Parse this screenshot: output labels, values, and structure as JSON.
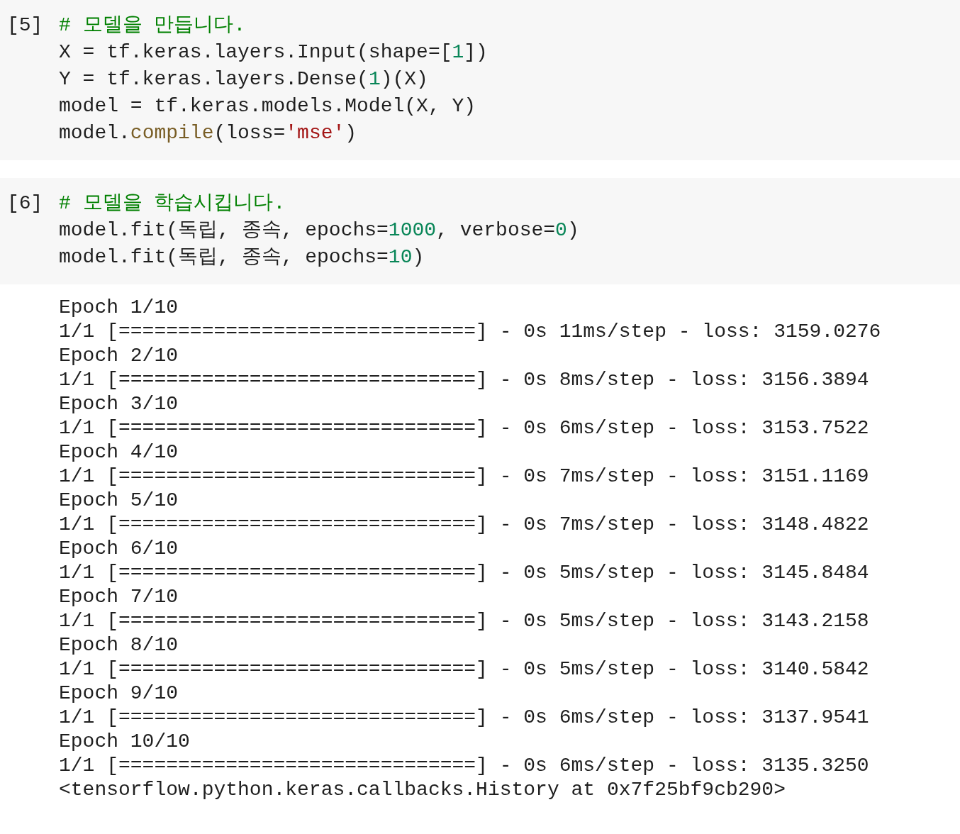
{
  "cells": [
    {
      "prompt": "[5]",
      "lines": [
        [
          {
            "kind": "comment",
            "text": "# 모델을 만듭니다."
          }
        ],
        [
          {
            "kind": "plain",
            "text": "X = tf.keras.layers.Input(shape=["
          },
          {
            "kind": "number",
            "text": "1"
          },
          {
            "kind": "plain",
            "text": "])"
          }
        ],
        [
          {
            "kind": "plain",
            "text": "Y = tf.keras.layers.Dense("
          },
          {
            "kind": "number",
            "text": "1"
          },
          {
            "kind": "plain",
            "text": ")(X)"
          }
        ],
        [
          {
            "kind": "plain",
            "text": "model = tf.keras.models.Model(X, Y)"
          }
        ],
        [
          {
            "kind": "plain",
            "text": "model."
          },
          {
            "kind": "function",
            "text": "compile"
          },
          {
            "kind": "plain",
            "text": "(loss="
          },
          {
            "kind": "string",
            "text": "'mse'"
          },
          {
            "kind": "plain",
            "text": ")"
          }
        ]
      ]
    },
    {
      "prompt": "[6]",
      "lines": [
        [
          {
            "kind": "comment",
            "text": "# 모델을 학습시킵니다."
          }
        ],
        [
          {
            "kind": "plain",
            "text": "model.fit(독립, 종속, epochs="
          },
          {
            "kind": "number",
            "text": "1000"
          },
          {
            "kind": "plain",
            "text": ", verbose="
          },
          {
            "kind": "number",
            "text": "0"
          },
          {
            "kind": "plain",
            "text": ")"
          }
        ],
        [
          {
            "kind": "plain",
            "text": "model.fit(독립, 종속, epochs="
          },
          {
            "kind": "number",
            "text": "10"
          },
          {
            "kind": "plain",
            "text": ")"
          }
        ]
      ],
      "output": [
        "Epoch 1/10",
        "1/1 [==============================] - 0s 11ms/step - loss: 3159.0276",
        "Epoch 2/10",
        "1/1 [==============================] - 0s 8ms/step - loss: 3156.3894",
        "Epoch 3/10",
        "1/1 [==============================] - 0s 6ms/step - loss: 3153.7522",
        "Epoch 4/10",
        "1/1 [==============================] - 0s 7ms/step - loss: 3151.1169",
        "Epoch 5/10",
        "1/1 [==============================] - 0s 7ms/step - loss: 3148.4822",
        "Epoch 6/10",
        "1/1 [==============================] - 0s 5ms/step - loss: 3145.8484",
        "Epoch 7/10",
        "1/1 [==============================] - 0s 5ms/step - loss: 3143.2158",
        "Epoch 8/10",
        "1/1 [==============================] - 0s 5ms/step - loss: 3140.5842",
        "Epoch 9/10",
        "1/1 [==============================] - 0s 6ms/step - loss: 3137.9541",
        "Epoch 10/10",
        "1/1 [==============================] - 0s 6ms/step - loss: 3135.3250",
        "<tensorflow.python.keras.callbacks.History at 0x7f25bf9cb290>"
      ]
    }
  ]
}
